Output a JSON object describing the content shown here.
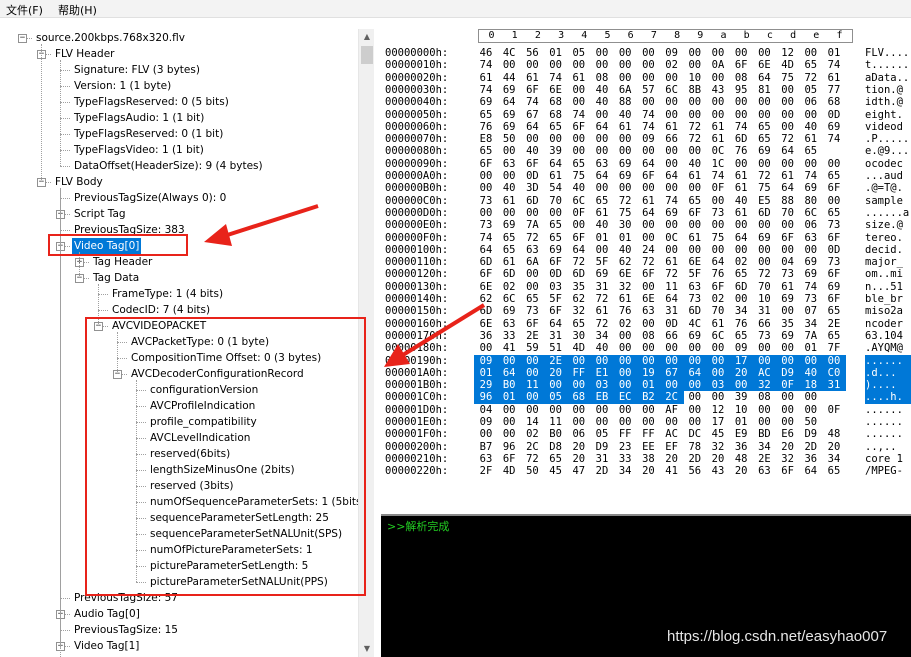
{
  "menu": {
    "file": "文件(F)",
    "help": "帮助(H)"
  },
  "tree": [
    {
      "label": "source.200kbps.768x320.flv",
      "depth": 0,
      "exp": "minus"
    },
    {
      "label": "FLV Header",
      "depth": 1,
      "exp": "minus"
    },
    {
      "label": "Signature: FLV  (3 bytes)",
      "depth": 2
    },
    {
      "label": "Version: 1  (1 byte)",
      "depth": 2
    },
    {
      "label": "TypeFlagsReserved: 0  (5 bits)",
      "depth": 2
    },
    {
      "label": "TypeFlagsAudio: 1  (1 bit)",
      "depth": 2
    },
    {
      "label": "TypeFlagsReserved: 0  (1 bit)",
      "depth": 2
    },
    {
      "label": "TypeFlagsVideo: 1  (1 bit)",
      "depth": 2
    },
    {
      "label": "DataOffset(HeaderSize): 9  (4 bytes)",
      "depth": 2
    },
    {
      "label": "FLV Body",
      "depth": 1,
      "exp": "minus"
    },
    {
      "label": "PreviousTagSize(Always 0): 0",
      "depth": 2
    },
    {
      "label": "Script Tag",
      "depth": 2,
      "exp": "plus"
    },
    {
      "label": "PreviousTagSize: 383",
      "depth": 2
    },
    {
      "label": "Video Tag[0]",
      "depth": 2,
      "exp": "minus",
      "selected": true
    },
    {
      "label": "Tag Header",
      "depth": 3,
      "exp": "plus"
    },
    {
      "label": "Tag Data",
      "depth": 3,
      "exp": "minus"
    },
    {
      "label": "FrameType: 1  (4 bits)",
      "depth": 4
    },
    {
      "label": "CodecID: 7  (4 bits)",
      "depth": 4
    },
    {
      "label": "AVCVIDEOPACKET",
      "depth": 4,
      "exp": "minus"
    },
    {
      "label": "AVCPacketType: 0  (1 byte)",
      "depth": 5
    },
    {
      "label": "CompositionTime Offset: 0  (3 bytes)",
      "depth": 5
    },
    {
      "label": "AVCDecoderConfigurationRecord",
      "depth": 5,
      "exp": "minus"
    },
    {
      "label": "configurationVersion",
      "depth": 6
    },
    {
      "label": "AVCProfileIndication",
      "depth": 6
    },
    {
      "label": "profile_compatibility",
      "depth": 6
    },
    {
      "label": "AVCLevelIndication",
      "depth": 6
    },
    {
      "label": "reserved(6bits)",
      "depth": 6
    },
    {
      "label": "lengthSizeMinusOne (2bits)",
      "depth": 6
    },
    {
      "label": "reserved (3bits)",
      "depth": 6
    },
    {
      "label": "numOfSequenceParameterSets: 1  (5bits)",
      "depth": 6
    },
    {
      "label": "sequenceParameterSetLength: 25",
      "depth": 6
    },
    {
      "label": "sequenceParameterSetNALUnit(SPS)",
      "depth": 6
    },
    {
      "label": "numOfPictureParameterSets: 1",
      "depth": 6
    },
    {
      "label": "pictureParameterSetLength: 5",
      "depth": 6
    },
    {
      "label": "pictureParameterSetNALUnit(PPS)",
      "depth": 6
    },
    {
      "label": "PreviousTagSize: 57",
      "depth": 2
    },
    {
      "label": "Audio Tag[0]",
      "depth": 2,
      "exp": "plus"
    },
    {
      "label": "PreviousTagSize: 15",
      "depth": 2
    },
    {
      "label": "Video Tag[1]",
      "depth": 2,
      "exp": "plus"
    }
  ],
  "hex": {
    "columns": [
      "0",
      "1",
      "2",
      "3",
      "4",
      "5",
      "6",
      "7",
      "8",
      "9",
      "a",
      "b",
      "c",
      "d",
      "e",
      "f"
    ],
    "rows": [
      {
        "off": "00000000h:",
        "b": "46 4C 56 01 05 00 00 00 09 00 00 00 00 12 00 01",
        "a": "FLV....."
      },
      {
        "off": "00000010h:",
        "b": "74 00 00 00 00 00 00 00 02 00 0A 6F 6E 4D 65 74",
        "a": "t......."
      },
      {
        "off": "00000020h:",
        "b": "61 44 61 74 61 08 00 00 00 10 00 08 64 75 72 61",
        "a": "aData.."
      },
      {
        "off": "00000030h:",
        "b": "74 69 6F 6E 00 40 6A 57 6C 8B 43 95 81 00 05 77",
        "a": "tion.@"
      },
      {
        "off": "00000040h:",
        "b": "69 64 74 68 00 40 88 00 00 00 00 00 00 00 06 68",
        "a": "idth.@"
      },
      {
        "off": "00000050h:",
        "b": "65 69 67 68 74 00 40 74 00 00 00 00 00 00 00 0D",
        "a": "eight."
      },
      {
        "off": "00000060h:",
        "b": "76 69 64 65 6F 64 61 74 61 72 61 74 65 00 40 69",
        "a": "videod"
      },
      {
        "off": "00000070h:",
        "b": "E8 50 00 00 00 00 00 09 66 72 61 6D 65 72 61 74",
        "a": ".P....."
      },
      {
        "off": "00000080h:",
        "b": "65 00 40 39 00 00 00 00 00 00 0C 76 69 64 65",
        "a": "e.@9..."
      },
      {
        "off": "00000090h:",
        "b": "6F 63 6F 64 65 63 69 64 00 40 1C 00 00 00 00 00",
        "a": "ocodec"
      },
      {
        "off": "000000A0h:",
        "b": "00 00 0D 61 75 64 69 6F 64 61 74 61 72 61 74 65",
        "a": "...aud"
      },
      {
        "off": "000000B0h:",
        "b": "00 40 3D 54 40 00 00 00 00 00 0F 61 75 64 69 6F",
        "a": ".@=T@."
      },
      {
        "off": "000000C0h:",
        "b": "73 61 6D 70 6C 65 72 61 74 65 00 40 E5 88 80 00",
        "a": "sample"
      },
      {
        "off": "000000D0h:",
        "b": "00 00 00 00 0F 61 75 64 69 6F 73 61 6D 70 6C 65",
        "a": "......a"
      },
      {
        "off": "000000E0h:",
        "b": "73 69 7A 65 00 40 30 00 00 00 00 00 00 00 06 73",
        "a": "size.@"
      },
      {
        "off": "000000F0h:",
        "b": "74 65 72 65 6F 01 01 00 0C 61 75 64 69 6F 63 6F",
        "a": "tereo."
      },
      {
        "off": "00000100h:",
        "b": "64 65 63 69 64 00 40 24 00 00 00 00 00 00 00 0D",
        "a": "decid."
      },
      {
        "off": "00000110h:",
        "b": "6D 61 6A 6F 72 5F 62 72 61 6E 64 02 00 04 69 73",
        "a": "major_"
      },
      {
        "off": "00000120h:",
        "b": "6F 6D 00 0D 6D 69 6E 6F 72 5F 76 65 72 73 69 6F",
        "a": "om..mi"
      },
      {
        "off": "00000130h:",
        "b": "6E 02 00 03 35 31 32 00 11 63 6F 6D 70 61 74 69",
        "a": "n...51"
      },
      {
        "off": "00000140h:",
        "b": "62 6C 65 5F 62 72 61 6E 64 73 02 00 10 69 73 6F",
        "a": "ble_br"
      },
      {
        "off": "00000150h:",
        "b": "6D 69 73 6F 32 61 76 63 31 6D 70 34 31 00 07 65",
        "a": "miso2a"
      },
      {
        "off": "00000160h:",
        "b": "6E 63 6F 64 65 72 02 00 0D 4C 61 76 66 35 34 2E",
        "a": "ncoder"
      },
      {
        "off": "00000170h:",
        "b": "36 33 2E 31 30 34 00 08 66 69 6C 65 73 69 7A 65",
        "a": "63.104"
      },
      {
        "off": "00000180h:",
        "b": "00 41 59 51 4D 40 00 00 00 00 00 09 00 00 01 7F",
        "a": ".AYQM@"
      },
      {
        "off": "00000190h:",
        "b": "09 00 00 2E 00 00 00 00 00 00 00 17 00 00 00 00",
        "a": "......",
        "hl": true
      },
      {
        "off": "000001A0h:",
        "b": "01 64 00 20 FF E1 00 19 67 64 00 20 AC D9 40 C0",
        "a": ".d...",
        "hl": true
      },
      {
        "off": "000001B0h:",
        "b": "29 B0 11 00 00 03 00 01 00 00 03 00 32 0F 18 31",
        "a": ")....",
        "hl": true
      },
      {
        "off": "000001C0h:",
        "b": "96 01 00 05 68 EB EC B2 2C",
        "a": "....h.",
        "hl": true,
        "hlcount": 9
      },
      {
        "off": "000001D0h:",
        "b": "04 00 00 00 00 00 00 00 AF 00 12 10 00 00 00 0F",
        "a": "......"
      },
      {
        "off": "000001E0h:",
        "b": "09 00 14 11 00 00 00 00 00 00 17 01 00 00 50",
        "a": "......"
      },
      {
        "off": "000001F0h:",
        "b": "00 00 02 B0 06 05 FF FF AC DC 45 E9 BD E6 D9 48",
        "a": "......"
      },
      {
        "off": "00000200h:",
        "b": "B7 96 2C D8 20 D9 23 EE EF 78 32 36 34 20 2D 20",
        "a": "..,.."
      },
      {
        "off": "00000210h:",
        "b": "63 6F 72 65 20 31 33 38 20 2D 20 48 2E 32 36 34",
        "a": "core 1"
      },
      {
        "off": "00000220h:",
        "b": "2F 4D 50 45 47 2D 34 20 41 56 43 20 63 6F 64 65",
        "a": "/MPEG-"
      }
    ],
    "tail": [
      "00 00 39 08 00 00",
      "00 00"
    ]
  },
  "console": {
    "text": ">>解析完成"
  },
  "watermark": "https://blog.csdn.net/easyhao007",
  "colors": {
    "selection": "#0078d7",
    "annotation": "#e8231a",
    "console_text": "#22cc22"
  }
}
